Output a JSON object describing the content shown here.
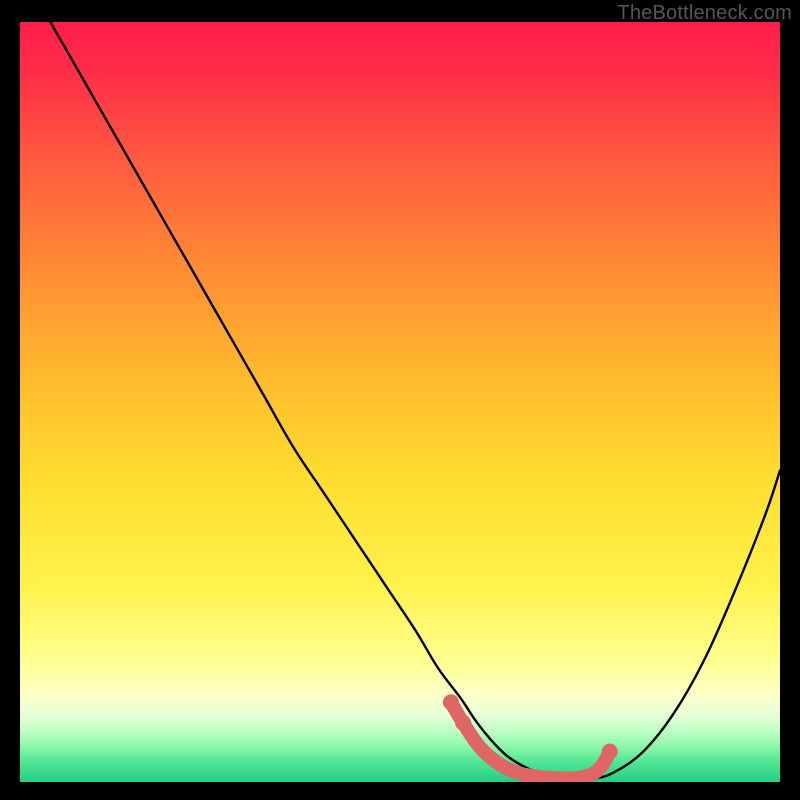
{
  "watermark": "TheBottleneck.com",
  "colors": {
    "frame_bg": "#000000",
    "gradient_top": "#ff1f4a",
    "gradient_mid_upper": "#ffab2e",
    "gradient_mid": "#ffe731",
    "gradient_low": "#fdffb0",
    "gradient_bottom1": "#8fff9a",
    "gradient_bottom2": "#25d383",
    "curve": "#000000",
    "marker": "#e06666"
  },
  "chart_data": {
    "type": "line",
    "title": "",
    "xlabel": "",
    "ylabel": "",
    "xlim": [
      0,
      100
    ],
    "ylim": [
      0,
      100
    ],
    "series": [
      {
        "name": "bottleneck-curve",
        "x": [
          4,
          8,
          12,
          16,
          20,
          24,
          28,
          32,
          36,
          40,
          44,
          48,
          52,
          55,
          58,
          60,
          62,
          64,
          66,
          68,
          70,
          72,
          75,
          78,
          82,
          86,
          90,
          94,
          98,
          100
        ],
        "y": [
          100,
          93,
          86,
          79,
          72,
          65,
          58,
          51,
          44,
          38,
          32,
          26,
          20,
          15,
          11,
          8,
          5.5,
          3.5,
          2.2,
          1.3,
          0.7,
          0.4,
          0.4,
          1.2,
          4,
          9,
          16,
          25,
          35,
          41
        ]
      }
    ],
    "markers": {
      "name": "highlight-band",
      "x": [
        56.7,
        58.3,
        60.5,
        63,
        65.5,
        68,
        70.5,
        73,
        75.2,
        76.6,
        77.6
      ],
      "y": [
        10.5,
        7.8,
        4.6,
        2.4,
        1.2,
        0.7,
        0.5,
        0.5,
        1.0,
        2.2,
        4.0
      ]
    }
  }
}
